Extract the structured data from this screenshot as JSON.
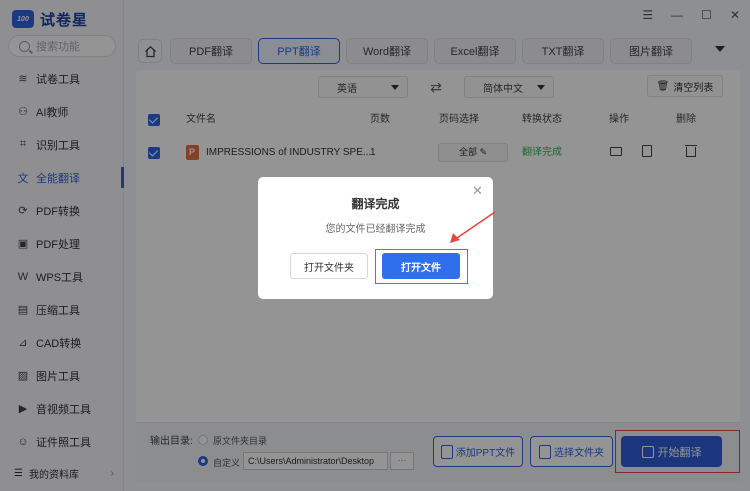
{
  "app": {
    "logo_badge": "100",
    "name": "试卷星"
  },
  "window_controls": {
    "menu": "☰",
    "minimize": "—",
    "maximize": "☐",
    "close": "✕"
  },
  "search": {
    "placeholder": "搜索功能"
  },
  "sidebar": {
    "items": [
      {
        "label": "试卷工具",
        "icon": "layers-icon",
        "glyph": "≋"
      },
      {
        "label": "AI教师",
        "icon": "ai-teacher-icon",
        "glyph": "⚇"
      },
      {
        "label": "识别工具",
        "icon": "scan-icon",
        "glyph": "⌗"
      },
      {
        "label": "全能翻译",
        "icon": "translate-icon",
        "glyph": "文"
      },
      {
        "label": "PDF转换",
        "icon": "pdf-convert-icon",
        "glyph": "⟳"
      },
      {
        "label": "PDF处理",
        "icon": "pdf-process-icon",
        "glyph": "▣"
      },
      {
        "label": "WPS工具",
        "icon": "wps-icon",
        "glyph": "W"
      },
      {
        "label": "压缩工具",
        "icon": "compress-icon",
        "glyph": "▤"
      },
      {
        "label": "CAD转换",
        "icon": "cad-icon",
        "glyph": "⊿"
      },
      {
        "label": "图片工具",
        "icon": "image-icon",
        "glyph": "▨"
      },
      {
        "label": "音视频工具",
        "icon": "media-icon",
        "glyph": "▶"
      },
      {
        "label": "证件照工具",
        "icon": "id-photo-icon",
        "glyph": "☺"
      }
    ],
    "active_index": 3,
    "library": "我的资料库"
  },
  "tabs": [
    "PDF翻译",
    "PPT翻译",
    "Word翻译",
    "Excel翻译",
    "TXT翻译",
    "图片翻译"
  ],
  "active_tab": "PPT翻译",
  "language": {
    "source": "英语",
    "target": "简体中文",
    "swap": "⇄"
  },
  "clear_list": "清空列表",
  "table": {
    "headers": {
      "filename": "文件名",
      "pages": "页数",
      "page_select": "页码选择",
      "status": "转换状态",
      "actions": "操作",
      "delete": "删除"
    },
    "rows": [
      {
        "filename": "IMPRESSIONS of INDUSTRY SPE...",
        "pages": "1",
        "page_select": "全部",
        "status": "翻译完成"
      }
    ]
  },
  "output": {
    "label": "输出目录:",
    "option_original": "原文件夹目录",
    "option_custom": "自定义",
    "path": "C:\\Users\\Administrator\\Desktop",
    "browse": "···"
  },
  "buttons": {
    "add_file": "添加PPT文件",
    "choose_folder": "选择文件夹",
    "start": "开始翻译"
  },
  "dialog": {
    "title": "翻译完成",
    "message": "您的文件已经翻译完成",
    "close": "✕",
    "open_folder": "打开文件夹",
    "open_file": "打开文件"
  },
  "colors": {
    "accent": "#2f63e6",
    "success": "#3fae54",
    "highlight": "#e8473b"
  }
}
